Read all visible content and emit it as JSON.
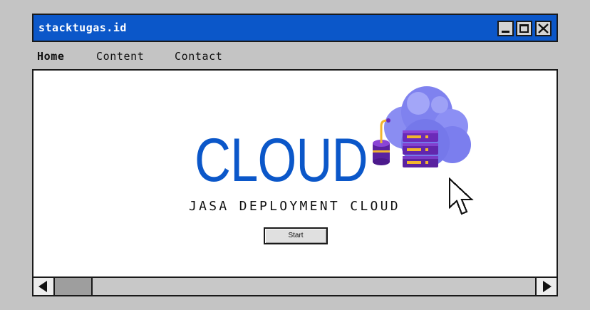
{
  "window": {
    "title": "stacktugas.id"
  },
  "menu": {
    "items": [
      {
        "label": "Home"
      },
      {
        "label": "Content"
      },
      {
        "label": "Contact"
      }
    ]
  },
  "hero": {
    "title": "CLOUD",
    "subtitle": "JASA DEPLOYMENT CLOUD",
    "start_label": "Start"
  },
  "icons": {
    "minimize": "minimize-icon",
    "maximize": "maximize-icon",
    "close": "close-icon",
    "illustration": "cloud-server-illustration",
    "cursor": "mouse-cursor-icon",
    "scroll_left": "triangle-left-icon",
    "scroll_right": "triangle-right-icon"
  },
  "colors": {
    "accent": "#0b57c9",
    "background": "#c4c4c4",
    "cloud": "#7c7ff0",
    "server": "#6b2ab8",
    "server_light": "#f2b52e"
  },
  "scrollbar": {
    "position": 0
  }
}
